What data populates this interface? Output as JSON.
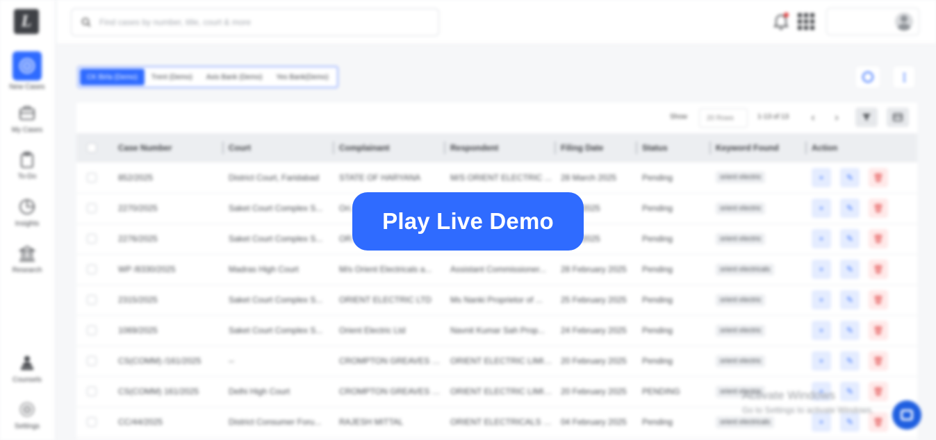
{
  "app": {
    "logo_letter": "L"
  },
  "sidebar": {
    "items": [
      {
        "label": "New Cases",
        "icon": "target-icon"
      },
      {
        "label": "My Cases",
        "icon": "briefcase-icon"
      },
      {
        "label": "To-Do",
        "icon": "clipboard-icon"
      },
      {
        "label": "Insights",
        "icon": "pie-chart-icon"
      },
      {
        "label": "Research",
        "icon": "courthouse-icon"
      },
      {
        "label": "Counsels",
        "icon": "counsel-icon"
      },
      {
        "label": "Settings",
        "icon": "gear-icon"
      }
    ]
  },
  "header": {
    "search_placeholder": "Find cases by number, title, court & more"
  },
  "clients": {
    "tabs": [
      "CK Birla (Demo)",
      "Trent (Demo)",
      "Axis Bank (Demo)",
      "Yes Bank(Demo)"
    ],
    "active_index": 0
  },
  "toolbar": {
    "show_label": "Show",
    "rows_value": "20 Rows",
    "page_info": "1-13 of 13",
    "prev": "‹",
    "next": "›"
  },
  "table": {
    "columns": [
      "Case Number",
      "Court",
      "Complainant",
      "Respondent",
      "Filing Date",
      "Status",
      "Keyword Found",
      "Action"
    ],
    "rows": [
      {
        "case": "852/2025",
        "court": "District Court, Faridabad",
        "complainant": "STATE OF HARYANA",
        "respondent": "M/S ORIENT ELECTRIC ...",
        "date": "28 March 2025",
        "status": "Pending",
        "keyword": "orient electric"
      },
      {
        "case": "2270/2025",
        "court": "Saket Court Complex S...",
        "complainant": "Ori...",
        "respondent": "",
        "date": "...rch 2025",
        "status": "Pending",
        "keyword": "orient electric"
      },
      {
        "case": "2276/2025",
        "court": "Saket Court Complex S...",
        "complainant": "OR...",
        "respondent": "",
        "date": "...rch 2025",
        "status": "Pending",
        "keyword": "orient electric"
      },
      {
        "case": "WP /8330/2025",
        "court": "Madras High Court",
        "complainant": "M/s Orient Electricals a...",
        "respondent": "Assistant Commissioner...",
        "date": "28 February 2025",
        "status": "Pending",
        "keyword": "orient electricals"
      },
      {
        "case": "2315/2025",
        "court": "Saket Court Complex S...",
        "complainant": "ORIENT ELECTRIC LTD",
        "respondent": "Ms Nanki Proprietor of ...",
        "date": "25 February 2025",
        "status": "Pending",
        "keyword": "orient electric"
      },
      {
        "case": "1069/2025",
        "court": "Saket Court Complex S...",
        "complainant": "Orient Electric Ltd",
        "respondent": "Navnit Kumar Sah Prop...",
        "date": "24 February 2025",
        "status": "Pending",
        "keyword": "orient electric"
      },
      {
        "case": "CS(COMM) /161/2025",
        "court": "--",
        "complainant": "CROMPTON GREAVES C...",
        "respondent": "ORIENT ELECTRIC LIMIT...",
        "date": "20 February 2025",
        "status": "Pending",
        "keyword": "orient electric"
      },
      {
        "case": "CS(COMM) 161/2025",
        "court": "Delhi High Court",
        "complainant": "CROMPTON GREAVES C...",
        "respondent": "ORIENT ELECTRIC LIMIT...",
        "date": "20 February 2025",
        "status": "PENDING",
        "keyword": "orient electric"
      },
      {
        "case": "CC/44/2025",
        "court": "District Consumer Foru...",
        "complainant": "RAJESH MITTAL",
        "respondent": "ORIENT ELECTRICALS LI...",
        "date": "04 February 2025",
        "status": "Pending",
        "keyword": "orient electricals"
      }
    ]
  },
  "watermark": {
    "title": "Activate Windows",
    "subtitle": "Go to Settings to activate Windows."
  },
  "overlay": {
    "button_label": "Play Live Demo"
  },
  "colors": {
    "accent": "#2f6bff",
    "danger": "#e24848"
  }
}
